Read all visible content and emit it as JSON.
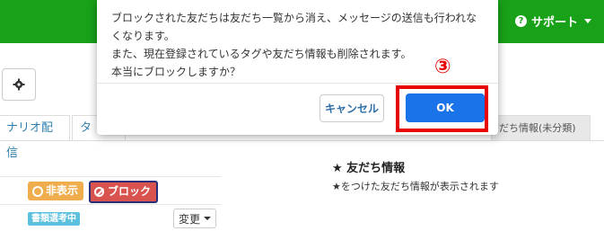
{
  "navbar": {
    "support_label": "サポート",
    "support_icon": "question-circle-icon",
    "brand_color": "#19a119"
  },
  "toolbar": {
    "settings_icon": "gear-icon"
  },
  "tabs": [
    {
      "label": "ナリオ配信"
    },
    {
      "label": "タ"
    },
    {
      "label": "だち情報(未分類)"
    }
  ],
  "row1": {
    "hidden_label": "非表示",
    "block_label": "ブロック"
  },
  "row2": {
    "status_tag": "書類選考中",
    "change_label": "変更"
  },
  "friend_info": {
    "title": "★ 友だち情報",
    "description": "★をつけた友だち情報が表示されます"
  },
  "modal": {
    "lines": [
      "ブロックされた友だちは友だち一覧から消え、メッセージの送信も行われな",
      "くなります。",
      "また、現在登録されているタグや友だち情報も削除されます。",
      "本当にブロックしますか？"
    ],
    "cancel_label": "キャンセル",
    "ok_label": "OK"
  },
  "annotation": {
    "step_label": "③",
    "color": "#e60000"
  }
}
